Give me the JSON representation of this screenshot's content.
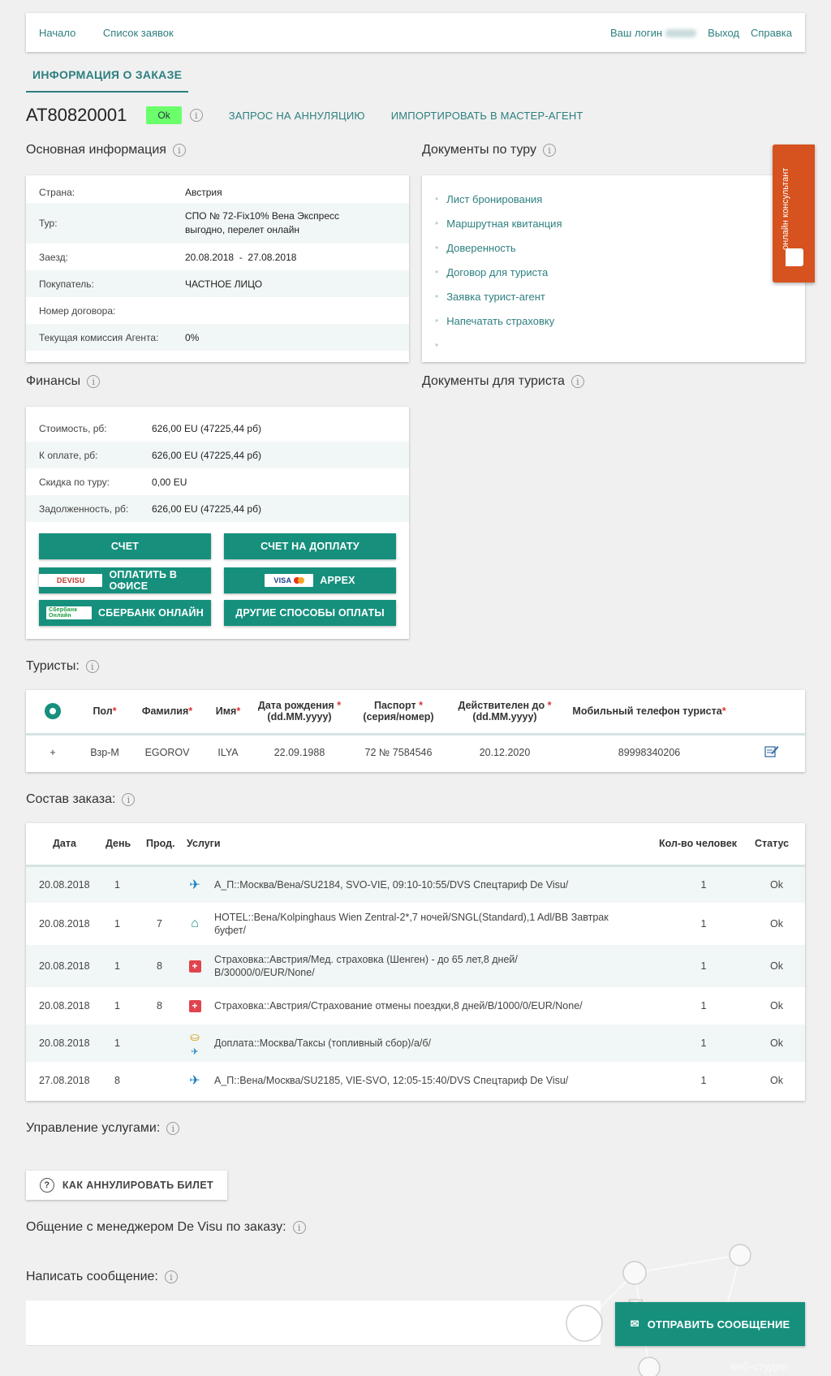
{
  "nav": {
    "home": "Начало",
    "orders": "Список заявок",
    "login_label": "Ваш логин",
    "logout": "Выход",
    "help": "Справка"
  },
  "tab": "ИНФОРМАЦИЯ О ЗАКАЗЕ",
  "order": {
    "id": "AT80820001",
    "status": "Ok",
    "cancel_request": "ЗАПРОС НА АННУЛЯЦИЮ",
    "import": "ИМПОРТИРОВАТЬ В МАСТЕР-АГЕНТ"
  },
  "sections": {
    "main_info": "Основная информация",
    "tour_docs": "Документы по туру",
    "finances": "Финансы",
    "tourist_docs": "Документы для туриста",
    "tourists": "Туристы:",
    "composition": "Состав заказа:",
    "service_mgmt": "Управление услугами:",
    "manager_chat": "Общение с менеджером De Visu по заказу:",
    "write_message": "Написать сообщение:"
  },
  "main_info": [
    {
      "k": "Страна:",
      "v": "Австрия"
    },
    {
      "k": "Тур:",
      "v": "СПО № 72-Fix10% Вена Экспресс выгодно, перелет онлайн"
    },
    {
      "k": "Заезд:",
      "v": "20.08.2018  -  27.08.2018"
    },
    {
      "k": "Покупатель:",
      "v": "ЧАСТНОЕ ЛИЦО"
    },
    {
      "k": "Номер договора:",
      "v": ""
    },
    {
      "k": "Текущая комиссия Агента:",
      "v": "0%"
    }
  ],
  "tour_docs": [
    "Лист бронирования",
    "Маршрутная квитанция",
    "Доверенность",
    "Договор для туриста",
    "Заявка турист-агент",
    "Напечатать страховку"
  ],
  "finances": [
    {
      "k": "Стоимость, рб:",
      "v": "626,00 EU (47225,44 рб)"
    },
    {
      "k": "К оплате, рб:",
      "v": "626,00 EU (47225,44 рб)"
    },
    {
      "k": "Скидка по туру:",
      "v": "0,00 EU"
    },
    {
      "k": "Задолженность, рб:",
      "v": "626,00 EU (47225,44 рб)"
    }
  ],
  "pay_buttons": {
    "invoice": "СЧЕТ",
    "invoice_extra": "СЧЕТ НА ДОПЛАТУ",
    "pay_office": "ОПЛАТИТЬ В ОФИСЕ",
    "appex": "APPEX",
    "sberbank": "СБЕРБАНК ОНЛАЙН",
    "other": "ДРУГИЕ СПОСОБЫ ОПЛАТЫ",
    "devisu_logo": "DEVISU",
    "visa_logo": "VISA",
    "sber_logo": "Сбербанк Онлайн"
  },
  "tourists": {
    "headers": {
      "sex": "Пол",
      "surname": "Фамилия",
      "name": "Имя",
      "dob": "Дата рождения",
      "dob_fmt": "(dd.MM.yyyy)",
      "passport": "Паспорт",
      "passport_fmt": "(серия/номер)",
      "valid": "Действителен до",
      "valid_fmt": "(dd.MM.yyyy)",
      "phone": "Мобильный телефон туриста",
      "star": "*"
    },
    "rows": [
      {
        "plus": "+",
        "sex": "Взр-М",
        "surname": "EGOROV",
        "name": "ILYA",
        "dob": "22.09.1988",
        "passport": "72 № 7584546",
        "valid": "20.12.2020",
        "phone": "89998340206"
      }
    ]
  },
  "composition": {
    "headers": {
      "date": "Дата",
      "day": "День",
      "prod": "Прод.",
      "services": "Услуги",
      "people": "Кол-во человек",
      "status": "Статус"
    },
    "rows": [
      {
        "date": "20.08.2018",
        "day": "1",
        "prod": "",
        "icon": "plane-icon",
        "service": "А_П::Москва/Вена/SU2184, SVO-VIE, 09:10-10:55/DVS Спецтариф De Visu/",
        "people": "1",
        "status": "Ok"
      },
      {
        "date": "20.08.2018",
        "day": "1",
        "prod": "7",
        "icon": "home-icon",
        "service": "HOTEL::Вена/Kolpinghaus Wien Zentral-2*,7 ночей/SNGL(Standard),1 Adl/BB Завтрак буфет/",
        "people": "1",
        "status": "Ok"
      },
      {
        "date": "20.08.2018",
        "day": "1",
        "prod": "8",
        "icon": "medical-cross-icon",
        "service": "Страховка::Австрия/Мед. страховка (Шенген) - до 65 лет,8 дней/В/30000/0/EUR/None/",
        "people": "1",
        "status": "Ok"
      },
      {
        "date": "20.08.2018",
        "day": "1",
        "prod": "8",
        "icon": "medical-cross-icon",
        "service": "Страховка::Австрия/Страхование отмены поездки,8 дней/В/1000/0/EUR/None/",
        "people": "1",
        "status": "Ok"
      },
      {
        "date": "20.08.2018",
        "day": "1",
        "prod": "",
        "icon": "coins-plane-icon",
        "service": "Доплата::Москва/Таксы (топливный сбор)/а/б/",
        "people": "1",
        "status": "Ok"
      },
      {
        "date": "27.08.2018",
        "day": "8",
        "prod": "",
        "icon": "plane-icon",
        "service": "А_П::Вена/Москва/SU2185, VIE-SVO, 12:05-15:40/DVS Спецтариф De Visu/",
        "people": "1",
        "status": "Ok"
      }
    ]
  },
  "howto": "КАК АННУЛИРОВАТЬ БИЛЕТ",
  "send": "ОТПРАВИТЬ СООБЩЕНИЕ",
  "consultant": "онлайн консультант",
  "watermark": {
    "main": "Фоксел",
    "sub": "веб-студия"
  },
  "colors": {
    "accent": "#2e7f7f",
    "button": "#16907d",
    "ok": "#6bff6b",
    "consult": "#d6521f"
  }
}
